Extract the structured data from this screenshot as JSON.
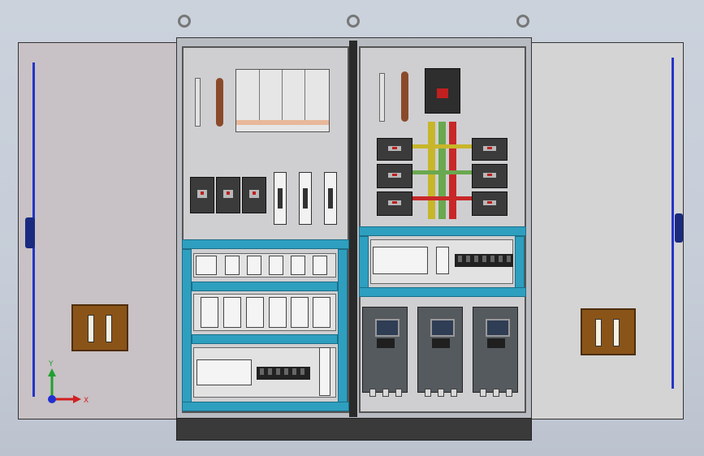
{
  "axis_indicator": {
    "x_label": "X",
    "y_label": "Y",
    "x_color": "#d02020",
    "y_color": "#20a030",
    "z_color": "#2030d0"
  },
  "colors": {
    "cable_tray": "#2e9fbf",
    "panel": "#cfcfd1",
    "left_door": "#c8c1c5",
    "right_door": "#d4d4d4",
    "busbar_yellow": "#c8b62a",
    "busbar_green": "#6aa84f",
    "busbar_red": "#c82828",
    "wood_block": "#8a5418",
    "door_rod": "#2335c8"
  }
}
